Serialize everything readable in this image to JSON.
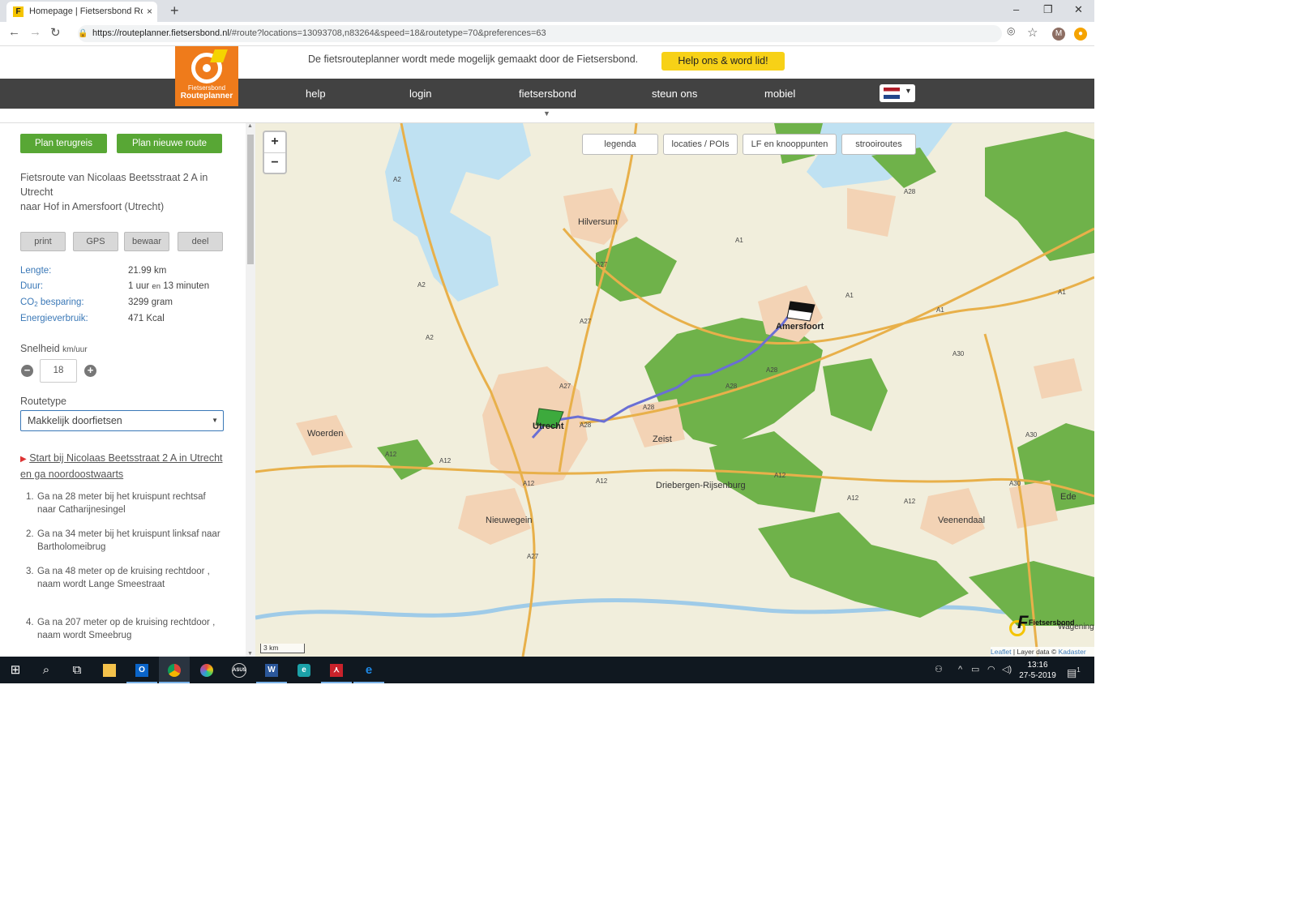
{
  "browser": {
    "tab_title": "Homepage | Fietsersbond Routepl",
    "favicon_letter": "F",
    "close_tab": "×",
    "new_tab": "+",
    "url_host": "https://routeplanner.fietsersbond.nl",
    "url_rest": "/#route?locations=13093708,n83264&speed=18&routetype=70&preferences=63",
    "profile_initial": "M",
    "window_controls": [
      "–",
      "❐",
      "✕"
    ]
  },
  "site": {
    "logo_line1": "Fietsersbond",
    "logo_line2": "Routeplanner",
    "sponsor_text": "De fietsrouteplanner wordt mede mogelijk gemaakt door de Fietsersbond.",
    "help_button": "Help ons & word lid!",
    "nav": [
      "help",
      "login",
      "fietsersbond",
      "steun ons",
      "mobiel"
    ],
    "language_flag": "NL"
  },
  "panel": {
    "plan_return": "Plan terugreis",
    "plan_new": "Plan nieuwe route",
    "route_title_1": "Fietsroute van Nicolaas Beetsstraat 2 A in Utrecht",
    "route_title_2": "naar Hof in Amersfoort (Utrecht)",
    "tools": [
      "print",
      "GPS",
      "bewaar",
      "deel"
    ],
    "stats": {
      "length_label": "Lengte:",
      "length_value": "21.99 km",
      "duration_label": "Duur:",
      "duration_value_1": "1 uur",
      "duration_en": "en",
      "duration_value_2": "13 minuten",
      "co2_label_pre": "CO",
      "co2_label_sub": "2",
      "co2_label_post": " besparing:",
      "co2_value": "3299  gram",
      "energy_label": "Energieverbruik:",
      "energy_value": "471 Kcal"
    },
    "speed_label": "Snelheid",
    "speed_unit": "km/uur",
    "speed_value": "18",
    "minus": "−",
    "plus": "+",
    "routetype_label": "Routetype",
    "routetype_value": "Makkelijk doorfietsen",
    "start_text": "Start bij Nicolaas Beetsstraat 2 A in Utrecht en ga noordoostwaarts",
    "steps": [
      {
        "n": "1.",
        "text": "Ga na 28 meter bij het kruispunt rechtsaf naar Catharijnesingel"
      },
      {
        "n": "2.",
        "text": "Ga na 34 meter bij het kruispunt linksaf naar Bartholomeibrug"
      },
      {
        "n": "3.",
        "text": "Ga na 48 meter op de kruising rechtdoor , naam wordt Lange Smeestraat"
      },
      {
        "n": "4.",
        "text": "Ga na 207 meter op de kruising rechtdoor , naam wordt Smeebrug"
      }
    ]
  },
  "map": {
    "zoom_in": "+",
    "zoom_out": "−",
    "layer_buttons": [
      "legenda",
      "locaties / POIs",
      "LF en knooppunten",
      "strooiroutes"
    ],
    "places": [
      "Hilversum",
      "Amersfoort",
      "Utrecht",
      "Woerden",
      "Zeist",
      "Driebergen-Rijsenburg",
      "Nieuwegein",
      "Veenendaal",
      "Ede",
      "Wageningen"
    ],
    "roads": [
      "A1",
      "A1",
      "A1",
      "A1",
      "A2",
      "A2",
      "A2",
      "A27",
      "A27",
      "A27",
      "A27",
      "A28",
      "A28",
      "A28",
      "A28",
      "A28",
      "A12",
      "A12",
      "A12",
      "A12",
      "A12",
      "A12",
      "A12",
      "A30",
      "A30",
      "A30"
    ],
    "scale": "3 km",
    "attribution_link1": "Leaflet",
    "attribution_mid": " | Layer data © ",
    "attribution_link2": "Kadaster",
    "watermark": "Fietsersbond",
    "colors": {
      "forest": "#6fb24a",
      "urban": "#f3d3b5",
      "water": "#bfe1f2",
      "route": "#6a6fd4",
      "land": "#f1eedc"
    }
  },
  "taskbar": {
    "time": "13:16",
    "date": "27-5-2019",
    "notification_count": "1",
    "apps": [
      "windows-start",
      "search",
      "task-view",
      "file-explorer",
      "outlook",
      "chrome",
      "paint",
      "asus",
      "word",
      "edge-beta",
      "acrobat",
      "edge"
    ]
  }
}
